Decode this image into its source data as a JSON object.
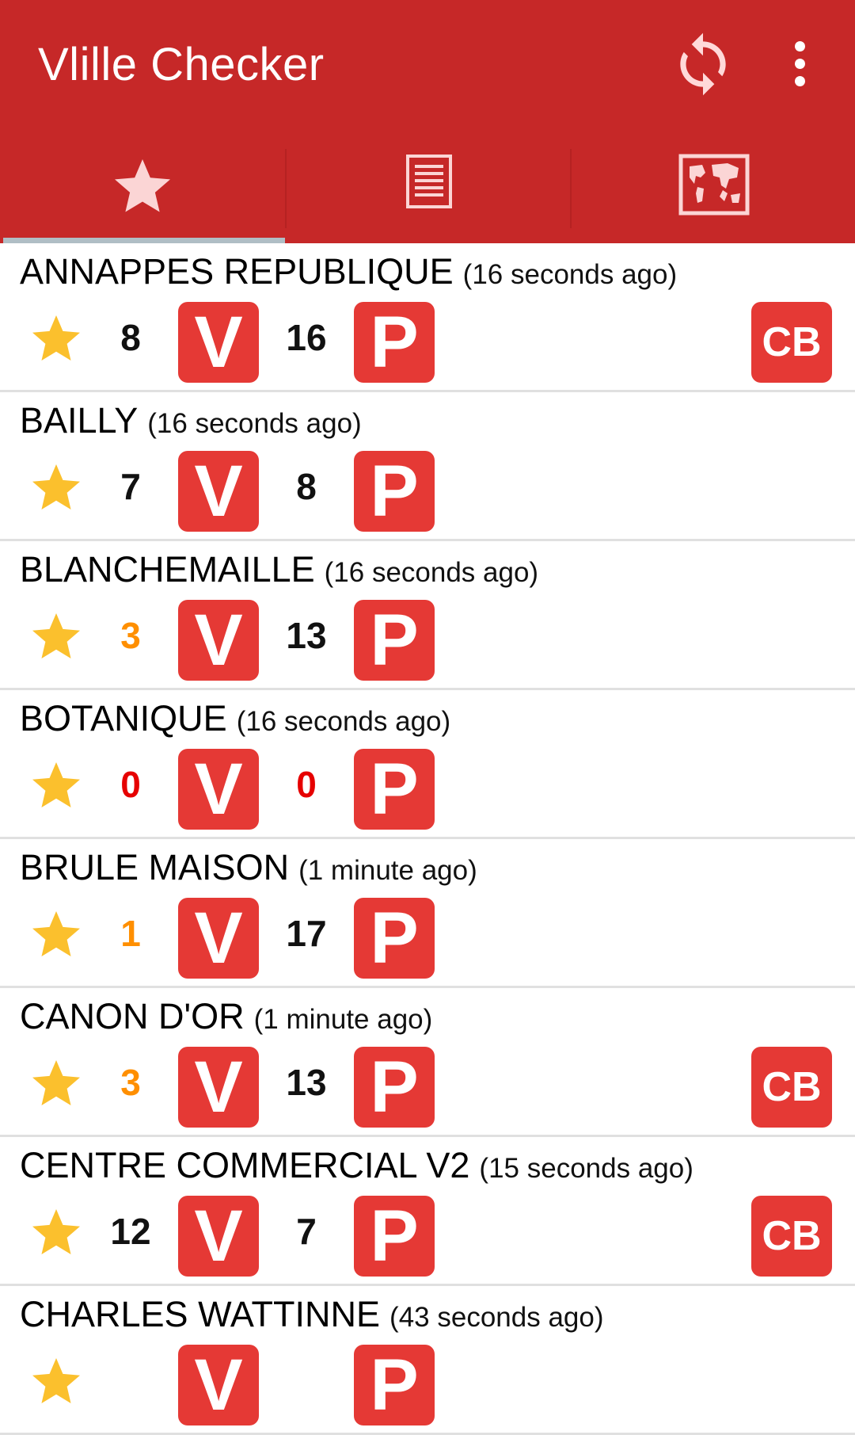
{
  "app": {
    "title": "Vlille Checker",
    "actions": {
      "refresh_icon": "refresh-icon",
      "menu_icon": "more-vert-icon"
    },
    "tabs": [
      {
        "icon": "star-icon",
        "selected": true
      },
      {
        "icon": "list-icon",
        "selected": false
      },
      {
        "icon": "map-icon",
        "selected": false
      }
    ]
  },
  "badges": {
    "bikes": "V",
    "parking": "P",
    "card": "CB"
  },
  "stations": [
    {
      "name": "ANNAPPES REPUBLIQUE",
      "updated": "(16 seconds ago)",
      "bikes": "8",
      "places": "16",
      "cb": true
    },
    {
      "name": "BAILLY",
      "updated": "(16 seconds ago)",
      "bikes": "7",
      "places": "8",
      "cb": false
    },
    {
      "name": "BLANCHEMAILLE",
      "updated": "(16 seconds ago)",
      "bikes": "3",
      "places": "13",
      "cb": false
    },
    {
      "name": "BOTANIQUE",
      "updated": "(16 seconds ago)",
      "bikes": "0",
      "places": "0",
      "cb": false
    },
    {
      "name": "BRULE MAISON",
      "updated": "(1 minute ago)",
      "bikes": "1",
      "places": "17",
      "cb": false
    },
    {
      "name": "CANON D'OR",
      "updated": "(1 minute ago)",
      "bikes": "3",
      "places": "13",
      "cb": true
    },
    {
      "name": "CENTRE COMMERCIAL V2",
      "updated": "(15 seconds ago)",
      "bikes": "12",
      "places": "7",
      "cb": true
    },
    {
      "name": "CHARLES WATTINNE",
      "updated": "(43 seconds ago)",
      "bikes": "",
      "places": "",
      "cb": false
    }
  ],
  "colors": {
    "primary": "#c62828",
    "badge": "#e53935",
    "star": "#fbc02d",
    "low": "#ff8f00",
    "empty": "#e60000"
  }
}
